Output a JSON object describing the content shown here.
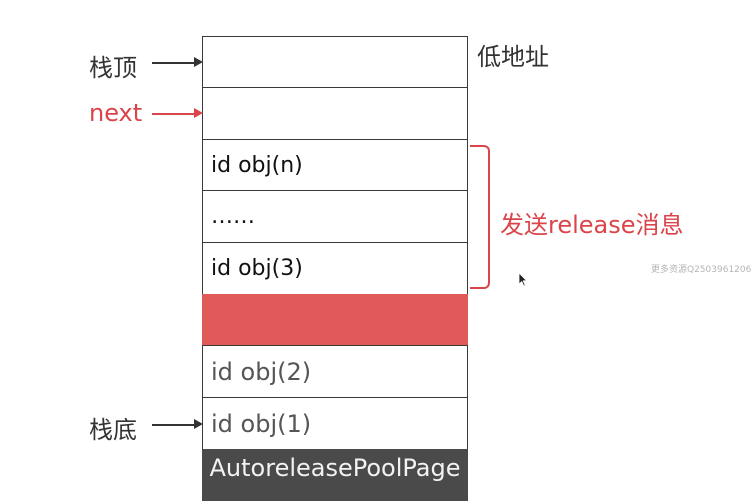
{
  "stack_cells": [
    {
      "text": "",
      "style": "plain"
    },
    {
      "text": "",
      "style": "plain"
    },
    {
      "text": "id obj(n)",
      "style": "plain"
    },
    {
      "text": "……",
      "style": "plain"
    },
    {
      "text": "id obj(3)",
      "style": "plain"
    },
    {
      "text": "",
      "style": "red"
    },
    {
      "text": "id obj(2)",
      "style": "gray"
    },
    {
      "text": "id obj(1)",
      "style": "gray"
    },
    {
      "text": "AutoreleasePoolPage",
      "style": "dark"
    }
  ],
  "labels": {
    "stack_top": "栈顶",
    "next": "next",
    "stack_bottom": "栈底",
    "low_address": "低地址",
    "send_release": "发送release消息"
  },
  "watermark": "更多资源Q2503961206",
  "colors": {
    "accent_red": "#d9454a",
    "fill_red": "#e05a5a",
    "dark_cell": "#4a4a4a"
  }
}
